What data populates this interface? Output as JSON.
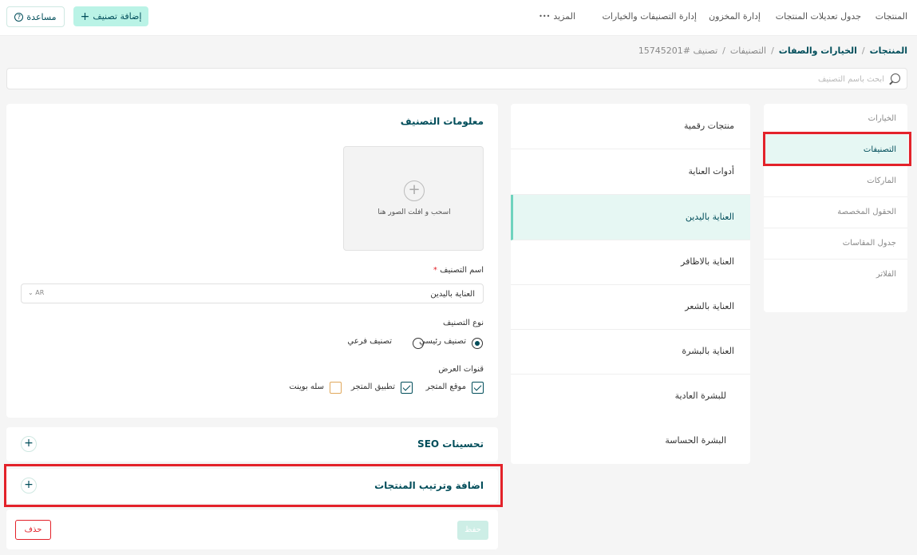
{
  "nav": {
    "items": [
      "المنتجات",
      "جدول تعديلات المنتجات",
      "إدارة المخزون",
      "إدارة التصنيفات والخيارات",
      "المزيد"
    ],
    "more_dots": "•••",
    "add_category": "إضافة تصنيف",
    "help": "مساعدة"
  },
  "breadcrumb": {
    "products": "المنتجات",
    "options_attributes": "الخيارات والصفات",
    "categories": "التصنيفات",
    "current": "تصنيف #15745201",
    "separator": "/"
  },
  "search": {
    "placeholder": "ابحث باسم التصنيف",
    "value": ""
  },
  "side_menu": {
    "items": [
      "الخيارات",
      "التصنيفات",
      "الماركات",
      "الحقول المخصصة",
      "جدول المقاسات",
      "الفلاتر"
    ],
    "active_index": 1
  },
  "categories": {
    "items": [
      "منتجات رقمية",
      "أدوات العناية",
      "العناية باليدين",
      "العناية بالاظافر",
      "العناية بالشعر",
      "العناية بالبشرة",
      "للبشرة العادية",
      "البشرة الحساسة"
    ],
    "active_index": 2
  },
  "form": {
    "title": "معلومات التصنيف",
    "dropzone_text": "اسحب و افلت الصور هنا",
    "name_label": "اسم التصنيف",
    "required_mark": "*",
    "name_value": "العناية باليدين",
    "lang": "AR",
    "type_label": "نوع التصنيف",
    "type_main": "تصنيف رئيسي",
    "type_sub": "تصنيف فرعي",
    "channels_label": "قنوات العرض",
    "channel_store": "موقع المتجر",
    "channel_app": "تطبيق المتجر",
    "channel_pos": "سله بوينت"
  },
  "seo": {
    "title": "تحسينات SEO"
  },
  "products_order": {
    "title": "اضافة وترتيب المنتجات"
  },
  "actions": {
    "save": "حفظ",
    "delete": "حذف"
  },
  "colors": {
    "primary": "#004d5a",
    "accent": "#baf3e6",
    "highlight": "#e3222a"
  }
}
